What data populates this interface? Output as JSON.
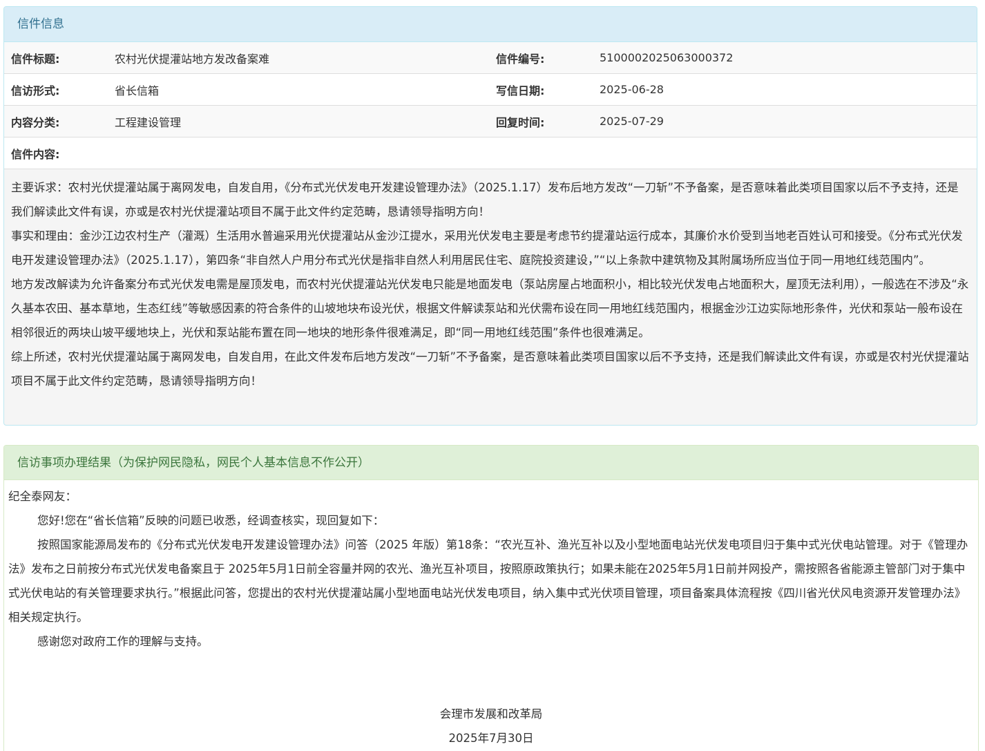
{
  "letter_info": {
    "heading": "信件信息",
    "rows": [
      {
        "label1": "信件标题:",
        "value1": "农村光伏提灌站地方发改备案难",
        "label2": "信件编号:",
        "value2": "5100002025063000372"
      },
      {
        "label1": "信访形式:",
        "value1": "省长信箱",
        "label2": "写信日期:",
        "value2": "2025-06-28"
      },
      {
        "label1": "内容分类:",
        "value1": "工程建设管理",
        "label2": "回复时间:",
        "value2": "2025-07-29"
      }
    ],
    "content_label": "信件内容:",
    "content_paragraphs": [
      "主要诉求：农村光伏提灌站属于离网发电，自发自用，《分布式光伏发电开发建设管理办法》（2025.1.17）发布后地方发改“一刀斩”不予备案，是否意味着此类项目国家以后不予支持，还是我们解读此文件有误，亦或是农村光伏提灌站项目不属于此文件约定范畴，恳请领导指明方向！",
      "事实和理由：金沙江边农村生产（灌溉）生活用水普遍采用光伏提灌站从金沙江提水，采用光伏发电主要是考虑节约提灌站运行成本，其廉价水价受到当地老百姓认可和接受。《分布式光伏发电开发建设管理办法》（2025.1.17），第四条“非自然人户用分布式光伏是指非自然人利用居民住宅、庭院投资建设，”“以上条款中建筑物及其附属场所应当位于同一用地红线范围内”。",
      "地方发改解读为允许备案分布式光伏发电需是屋顶发电，而农村光伏提灌站光伏发电只能是地面发电（泵站房屋占地面积小，相比较光伏发电占地面积大，屋顶无法利用），一般选在不涉及“永久基本农田、基本草地，生态红线”等敏感因素的符合条件的山坡地块布设光伏，根据文件解读泵站和光伏需布设在同一用地红线范围内，根据金沙江边实际地形条件，光伏和泵站一般布设在相邻很近的两块山坡平缓地块上，光伏和泵站能布置在同一地块的地形条件很难满足，即“同一用地红线范围”条件也很难满足。",
      "综上所述，农村光伏提灌站属于离网发电，自发自用，在此文件发布后地方发改“一刀斩”不予备案，是否意味着此类项目国家以后不予支持，还是我们解读此文件有误，亦或是农村光伏提灌站项目不属于此文件约定范畴，恳请领导指明方向！"
    ]
  },
  "reply": {
    "heading": "信访事项办理结果（为保护网民隐私，网民个人基本信息不作公开）",
    "salutation": "纪全泰网友：",
    "paragraphs": [
      "您好!您在“省长信箱”反映的问题已收悉，经调查核实，现回复如下：",
      "按照国家能源局发布的《分布式光伏发电开发建设管理办法》问答（2025 年版）第18条：“农光互补、渔光互补以及小型地面电站光伏发电项目归于集中式光伏电站管理。对于《管理办法》发布之日前按分布式光伏发电备案且于 2025年5月1日前全容量并网的农光、渔光互补项目，按照原政策执行；如果未能在2025年5月1日前并网投产，需按照各省能源主管部门对于集中式光伏电站的有关管理要求执行。”根据此问答，您提出的农村光伏提灌站属小型地面电站光伏发电项目，纳入集中式光伏项目管理，项目备案具体流程按《四川省光伏风电资源开发管理办法》相关规定执行。",
      "感谢您对政府工作的理解与支持。"
    ],
    "signature_org": "会理市发展和改革局",
    "signature_date": "2025年7月30日"
  }
}
